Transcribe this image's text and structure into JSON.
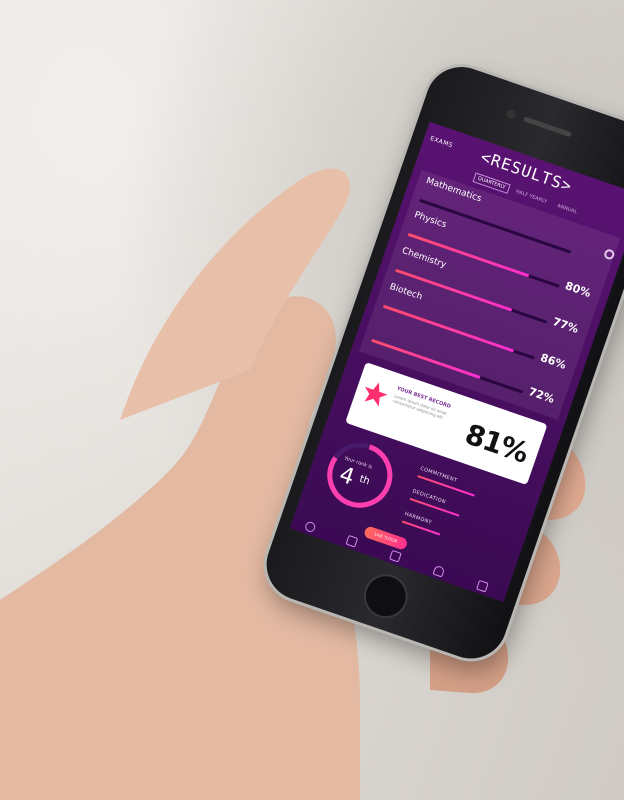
{
  "screen": {
    "exams_link": "EXAMS",
    "title": "RESULTS",
    "title_left_bracket": "<",
    "title_right_bracket": ">",
    "segments": [
      "QUARTERLY",
      "HALF YEARLY",
      "ANNUAL"
    ],
    "active_segment": "QUARTERLY",
    "subjects": [
      {
        "name": "Mathematics",
        "percent": "",
        "fill": 0
      },
      {
        "name": "Physics",
        "percent": "80%",
        "fill": 0.8
      },
      {
        "name": "Chemistry",
        "percent": "77%",
        "fill": 0.77
      },
      {
        "name": "Biotech",
        "percent": "86%",
        "fill": 0.86
      },
      {
        "name": "",
        "percent": "72%",
        "fill": 0.72
      }
    ],
    "overall": {
      "heading": "YOUR BEST RECORD",
      "description": "Lorem ipsum dolor sit amet consectetur adipiscing elit",
      "score": "81%"
    },
    "rank": {
      "caption": "Your rank is",
      "value": "4",
      "suffix": "th"
    },
    "traits": [
      "COMMITMENT",
      "DEDICATION",
      "HARMONY"
    ],
    "cta": "LIVE TUTOR",
    "tab_icons": [
      "home-icon",
      "calendar-icon",
      "book-icon",
      "medal-icon",
      "chat-icon"
    ],
    "colors": {
      "background_top": "#5a1272",
      "background_bottom": "#3a0b52",
      "accent_start": "#ff4d6d",
      "accent_end": "#ff2fd1",
      "card": "#ffffff",
      "star": "#ff2f6f"
    }
  }
}
